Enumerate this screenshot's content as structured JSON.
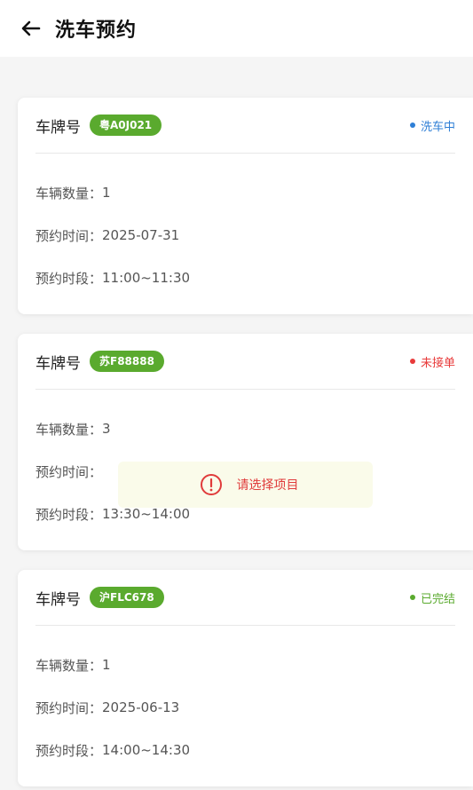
{
  "header": {
    "title": "洗车预约"
  },
  "colors": {
    "badge_green": "#5aaa2e",
    "status_washing": "#2f7fd6",
    "status_pending": "#e83a3a",
    "status_done": "#5aaa2e",
    "toast_text": "#e03b3b"
  },
  "labels": {
    "plate": "车牌号",
    "count": "车辆数量：",
    "date": "预约时间：",
    "slot": "预约时段："
  },
  "orders": [
    {
      "plate": "粤A0J021",
      "status": "洗车中",
      "count": "1",
      "date": "2025-07-31",
      "slot": "11:00~11:30"
    },
    {
      "plate": "苏F88888",
      "status": "未接单",
      "count": "3",
      "date": "",
      "slot": "13:30~14:00"
    },
    {
      "plate": "沪FLC678",
      "status": "已完结",
      "count": "1",
      "date": "2025-06-13",
      "slot": "14:00~14:30"
    }
  ],
  "toast": {
    "icon": "alert-circle-icon",
    "message": "请选择项目"
  }
}
